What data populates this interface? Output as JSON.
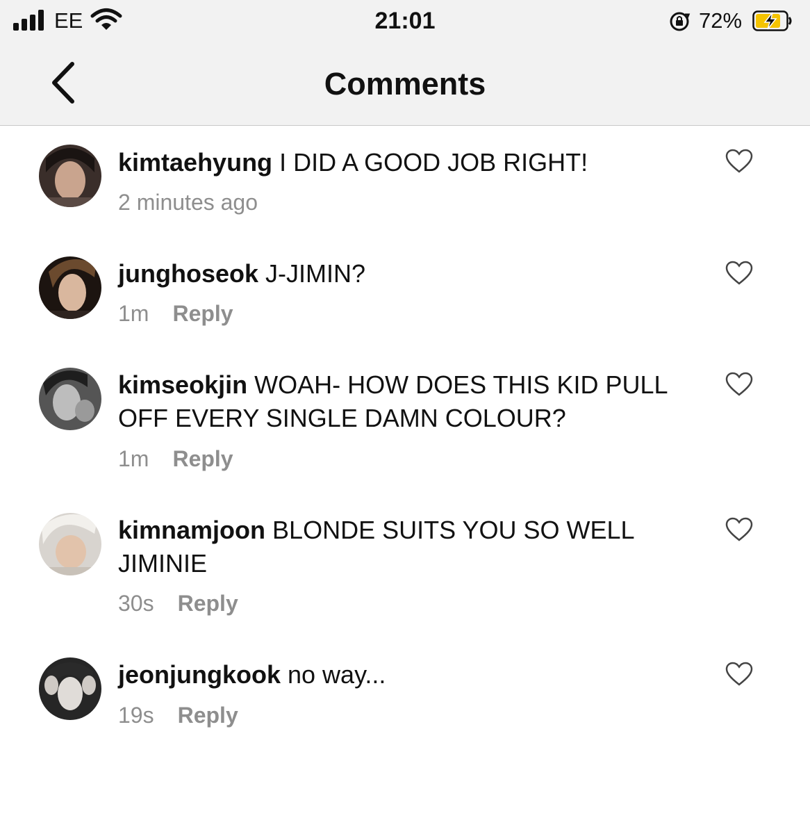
{
  "status_bar": {
    "carrier": "EE",
    "time": "21:01",
    "battery": "72%"
  },
  "header": {
    "title": "Comments",
    "back_icon": "chevron-left-icon"
  },
  "comments": [
    {
      "username": "kimtaehyung",
      "text": "I DID A GOOD JOB RIGHT!",
      "time": "2 minutes ago",
      "reply": ""
    },
    {
      "username": "junghoseok",
      "text": "J-JIMIN?",
      "time": "1m",
      "reply": "Reply"
    },
    {
      "username": "kimseokjin",
      "text": "WOAH- HOW DOES THIS KID PULL OFF EVERY SINGLE DAMN COLOUR?",
      "time": "1m",
      "reply": "Reply"
    },
    {
      "username": "kimnamjoon",
      "text": "BLONDE SUITS YOU SO WELL JIMINIE",
      "time": "30s",
      "reply": "Reply"
    },
    {
      "username": "jeonjungkook",
      "text": "no way...",
      "time": "19s",
      "reply": "Reply"
    }
  ],
  "colors": {
    "topbar_bg": "#f2f2f2",
    "meta_gray": "#8e8e8e",
    "battery_charging": "#f5c400"
  }
}
